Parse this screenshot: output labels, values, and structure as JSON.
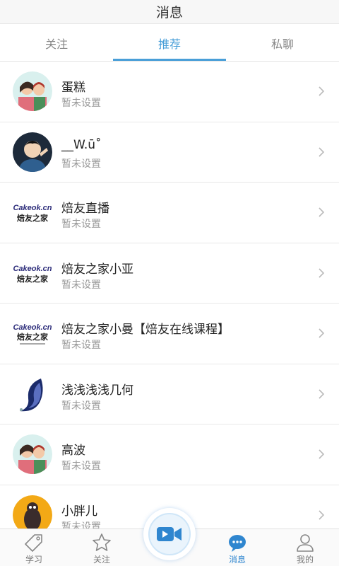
{
  "header": {
    "title": "消息"
  },
  "tabs": [
    {
      "label": "关注"
    },
    {
      "label": "推荐"
    },
    {
      "label": "私聊"
    }
  ],
  "messages": [
    {
      "name": "蛋糕",
      "status": "暂未设置",
      "avatar": "cartoon-couple-avatar"
    },
    {
      "name": "__W.ū˚",
      "status": "暂未设置",
      "avatar": "astronaut-avatar"
    },
    {
      "name": "焙友直播",
      "status": "暂未设置",
      "avatar": "cakeok-logo"
    },
    {
      "name": "焙友之家小亚",
      "status": "暂未设置",
      "avatar": "cakeok-logo"
    },
    {
      "name": "焙友之家小曼【焙友在线课程】",
      "status": "暂未设置",
      "avatar": "cakeok-logo"
    },
    {
      "name": "浅浅浅浅几何",
      "status": "暂未设置",
      "avatar": "crescent-figure-avatar"
    },
    {
      "name": "高波",
      "status": "暂未设置",
      "avatar": "cartoon-couple-avatar"
    },
    {
      "name": "小胖儿",
      "status": "暂未设置",
      "avatar": "yellow-cartoon-avatar"
    }
  ],
  "bottom_nav": [
    {
      "label": "学习",
      "icon": "tag-icon"
    },
    {
      "label": "关注",
      "icon": "star-icon"
    },
    {
      "label": "消息",
      "icon": "chat-bubble-icon"
    },
    {
      "label": "我的",
      "icon": "user-icon"
    }
  ],
  "colors": {
    "accent": "#4a9fd8",
    "nav_active": "#2f86cf"
  },
  "logo_text": {
    "cakeok": "Cakeok.cn",
    "brand": "焙友之家"
  }
}
